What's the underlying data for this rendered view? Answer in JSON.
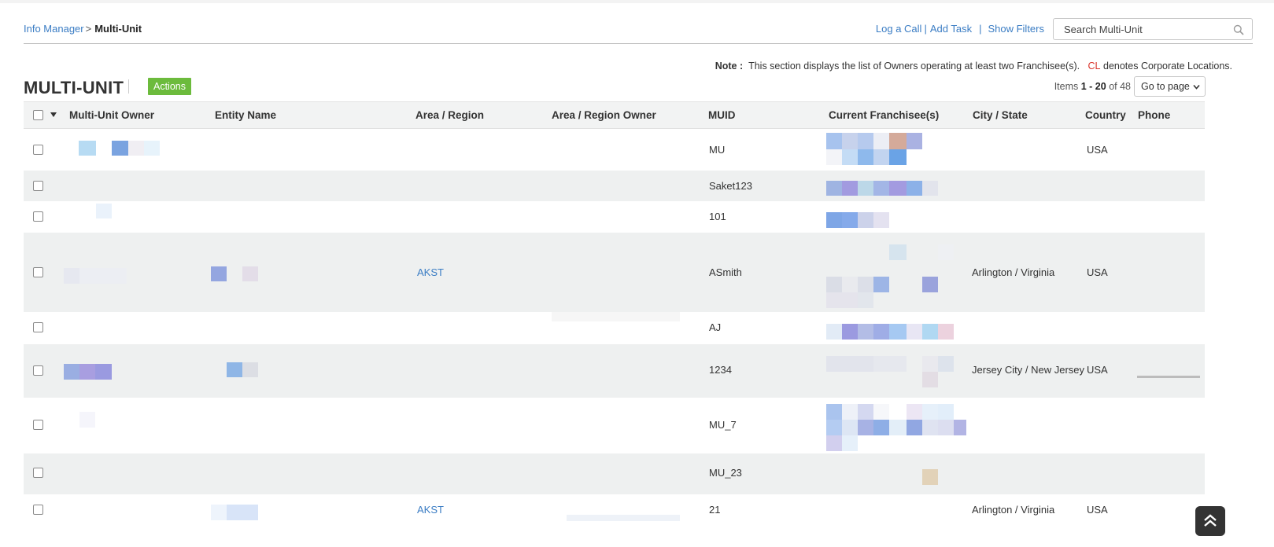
{
  "breadcrumb": {
    "root": "Info Manager",
    "separator": ">",
    "current": "Multi-Unit"
  },
  "toplinks": {
    "log_call": "Log a Call",
    "add_task": "Add Task",
    "show_filters": "Show Filters",
    "pipe": "|"
  },
  "search": {
    "placeholder": "Search Multi-Unit",
    "icon": "search-icon"
  },
  "note": {
    "label": "Note :",
    "text": "This section displays the list of Owners operating at least two Franchisee(s).",
    "cl": "CL",
    "cl_text": "denotes Corporate Locations."
  },
  "title": "MULTI-UNIT",
  "actions_label": "Actions",
  "pager": {
    "prefix": "Items",
    "range": "1 - 20",
    "of": "of 48",
    "goto_label": "Go to page"
  },
  "columns": [
    "Multi-Unit Owner",
    "Entity Name",
    "Area / Region",
    "Area / Region Owner",
    "MUID",
    "Current Franchisee(s)",
    "City / State",
    "Country",
    "Phone"
  ],
  "rows": [
    {
      "muid": "MU",
      "area": "",
      "city": "",
      "country": "USA"
    },
    {
      "muid": "Saket123",
      "area": "",
      "city": "",
      "country": ""
    },
    {
      "muid": "101",
      "area": "",
      "city": "",
      "country": ""
    },
    {
      "muid": "ASmith",
      "area": "AKST",
      "city": "Arlington / Virginia",
      "country": "USA"
    },
    {
      "muid": "AJ",
      "area": "",
      "city": "",
      "country": ""
    },
    {
      "muid": "1234",
      "area": "",
      "city": "Jersey City / New Jersey",
      "country": "USA"
    },
    {
      "muid": "MU_7",
      "area": "",
      "city": "",
      "country": ""
    },
    {
      "muid": "MU_23",
      "area": "",
      "city": "",
      "country": ""
    },
    {
      "muid": "21",
      "area": "AKST",
      "city": "Arlington / Virginia",
      "country": "USA"
    }
  ],
  "colors": {
    "link": "#3b7dc4",
    "actions_bg": "#6cbb3c",
    "cl_red": "#d9342b",
    "alt_row": "#eef0f0"
  }
}
